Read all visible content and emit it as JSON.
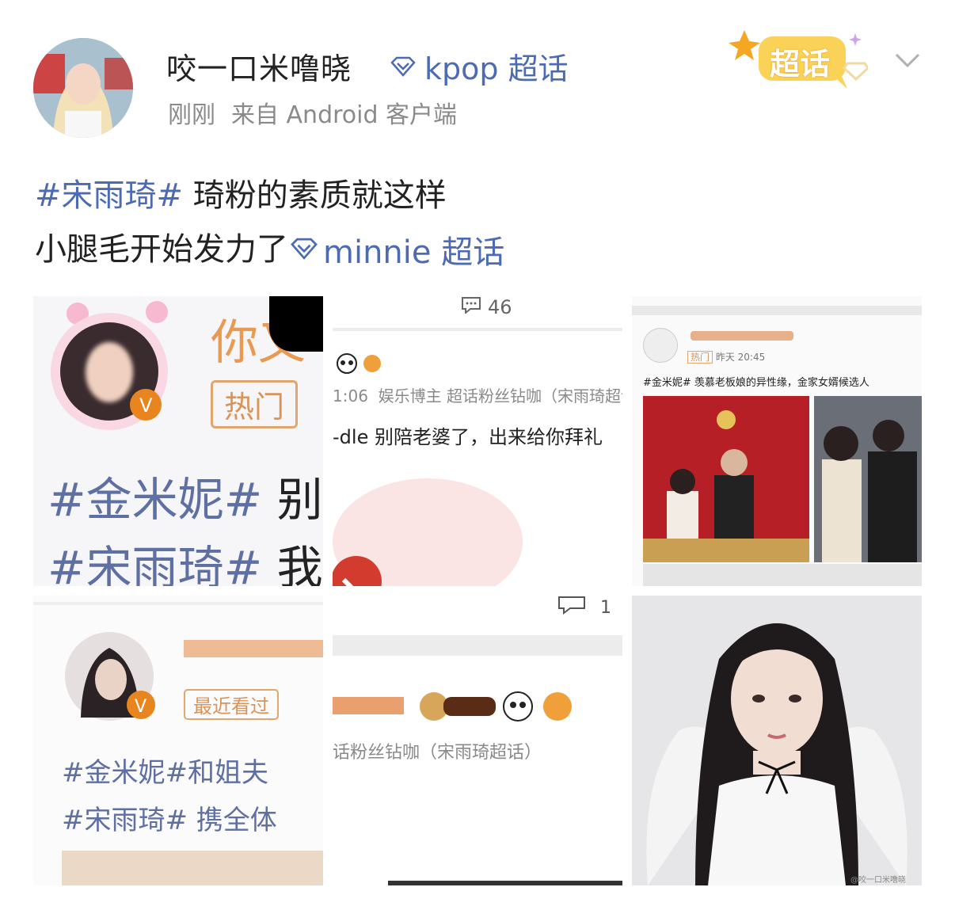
{
  "post": {
    "username": "咬一口米噜晓",
    "topic_link": "kpop 超话",
    "time": "刚刚",
    "source": "来自 Android 客户端",
    "badge": "超话",
    "line1_tag": "#宋雨琦#",
    "line1_text": " 琦粉的素质就这样",
    "line2_text": "小腿毛开始发力了",
    "line2_topic": "minnie 超话"
  },
  "images": {
    "img1": {
      "name_fragment": "你叉",
      "tag_hot": "热门",
      "text1_tag": "#金米妮#",
      "text1": " 别",
      "text2_tag": "#宋雨琦#",
      "text2": " 我"
    },
    "img2": {
      "comment_count": "46",
      "time_fragment": "1:06",
      "meta": "娱乐博主 超话粉丝钻咖（宋雨琦超话",
      "text": "-dle 别陪老婆了，出来给你拜礼"
    },
    "img3": {
      "time_tag": "热门",
      "time": "昨天 20:45",
      "text": "#金米妮# 羡慕老板娘的异性缘，金家女婿候选人"
    },
    "img4": {
      "tag_recent": "最近看过",
      "text1": "#金米妮#和姐夫",
      "text2": "#宋雨琦# 携全体"
    },
    "img5": {
      "comment_count": "1",
      "meta": "话粉丝钻咖（宋雨琦超话）"
    },
    "img6": {
      "watermark": "@咬一口米噜晓"
    }
  },
  "colors": {
    "link": "#4d6bb3",
    "meta": "#8a8a8a",
    "badge": "#f5b53a"
  },
  "icons": [
    "diamond-icon",
    "chevron-down-icon",
    "comment-icon",
    "verified-icon",
    "panda-icon"
  ]
}
